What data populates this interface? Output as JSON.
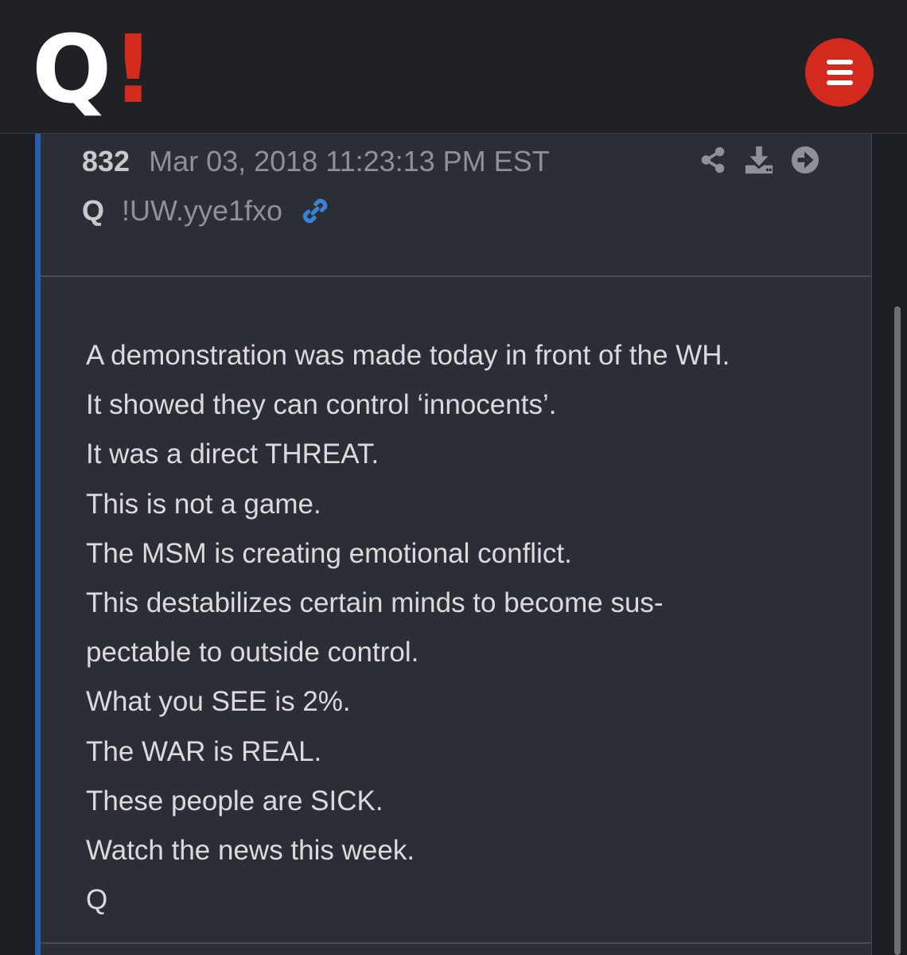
{
  "header": {
    "logo_letter": "Q",
    "logo_mark": "!",
    "menu_icon": "hamburger-menu-icon",
    "brand_color": "#d42a1e"
  },
  "post": {
    "number": "832",
    "timestamp": "Mar 03, 2018 11:23:13 PM EST",
    "author": "Q",
    "tripcode": "!UW.yye1fxo",
    "link_icon": "link-icon",
    "actions": [
      "share-icon",
      "download-icon",
      "forward-icon"
    ],
    "accent_color": "#2a5ea8",
    "lines": [
      "A demonstration was made today in front of the WH.",
      "It showed they can control ‘innocents’.",
      "It was a direct THREAT.",
      "This is not a game.",
      "The MSM is creating emotional conflict.",
      "This destabilizes certain minds to become sus-",
      "pectable to outside control.",
      "What you SEE is 2%.",
      "The WAR is REAL.",
      "These people are SICK.",
      "Watch the news this week.",
      "Q"
    ]
  }
}
